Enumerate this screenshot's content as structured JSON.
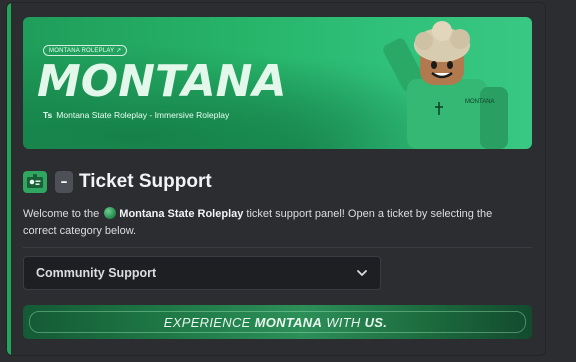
{
  "banner": {
    "tag": "MONTANA ROLEPLAY ↗",
    "title": "MONTANA",
    "subtitle_glyph": "Ts",
    "subtitle": "Montana State Roleplay - Immersive Roleplay",
    "shirt_text": "MONTANA"
  },
  "panel": {
    "dash": "–",
    "title": "Ticket Support",
    "desc_prefix": "Welcome to the ",
    "desc_bold": "Montana State Roleplay",
    "desc_suffix": " ticket support panel! Open a ticket by selecting the correct category below."
  },
  "select": {
    "value": "Community Support"
  },
  "footer": {
    "pre": "EXPERIENCE",
    "bold": "MONTANA",
    "mid": "WITH",
    "end": "US."
  },
  "colors": {
    "accent": "#23a55a",
    "banner_green": "#27b56a",
    "background": "#2b2d31",
    "select_bg": "#1e1f22"
  },
  "icons": {
    "heading_emoji": "id-card-icon",
    "description_emoji": "globe-icon",
    "select_chevron": "chevron-down-icon"
  }
}
